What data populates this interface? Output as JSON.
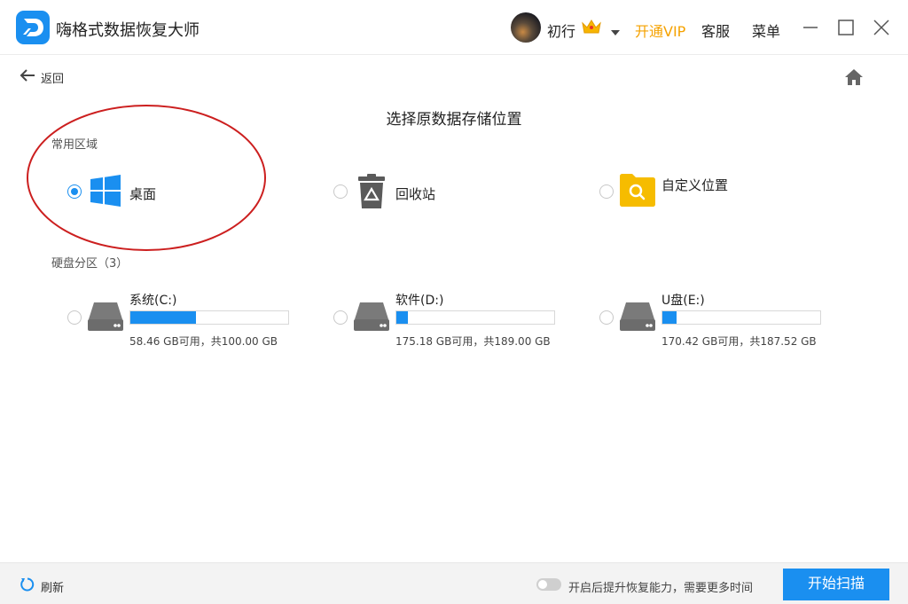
{
  "app": {
    "title": "嗨格式数据恢复大师",
    "logo_icon": "app-logo-icon",
    "brand_color": "#1a8ff0"
  },
  "header": {
    "username": "初行",
    "vip_label": "开通VIP",
    "vip_color": "#f5a200",
    "service_label": "客服",
    "menu_label": "菜单",
    "icons": [
      "crown-icon",
      "dropdown-arrow-icon",
      "minimize-icon",
      "maximize-icon",
      "close-icon"
    ]
  },
  "nav": {
    "back_label": "返回",
    "home_icon": "home-icon"
  },
  "main": {
    "title": "选择原数据存储位置",
    "common_section_label": "常用区域",
    "common_locations": [
      {
        "label": "桌面",
        "icon": "windows-icon",
        "selected": true
      },
      {
        "label": "回收站",
        "icon": "recycle-bin-icon",
        "selected": false
      },
      {
        "label": "自定义位置",
        "icon": "folder-search-icon",
        "selected": false
      }
    ],
    "disk_section_label": "硬盘分区（3）",
    "drives": [
      {
        "name": "系统(C:)",
        "info": "58.46 GB可用，共100.00 GB",
        "used_fraction": 0.415,
        "icon": "hard-drive-icon"
      },
      {
        "name": "软件(D:)",
        "info": "175.18 GB可用，共189.00 GB",
        "used_fraction": 0.073,
        "icon": "hard-drive-icon"
      },
      {
        "name": "U盘(E:)",
        "info": "170.42 GB可用，共187.52 GB",
        "used_fraction": 0.091,
        "icon": "hard-drive-icon"
      }
    ]
  },
  "footer": {
    "refresh_label": "刷新",
    "toggle_label": "开启后提升恢复能力，需要更多时间",
    "toggle_on": false,
    "scan_button_label": "开始扫描"
  }
}
